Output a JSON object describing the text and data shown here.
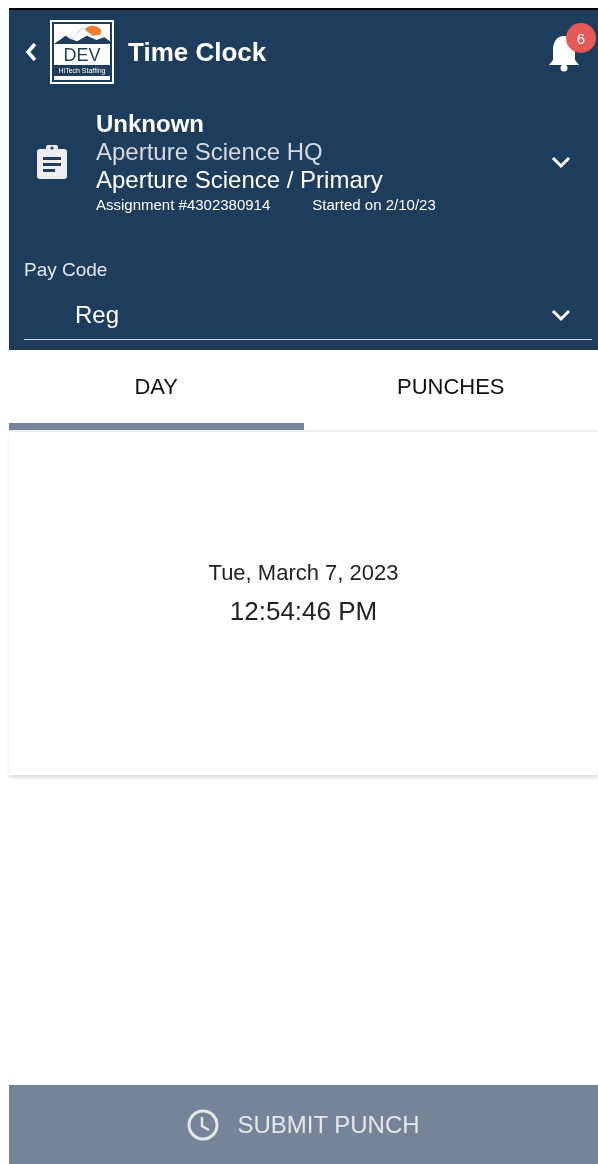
{
  "header": {
    "title": "Time Clock",
    "logo": {
      "main": "DEV",
      "sub": "HiTech Staffing"
    },
    "notification_count": "6"
  },
  "assignment": {
    "name": "Unknown",
    "location": "Aperture Science HQ",
    "client": "Aperture Science / Primary",
    "number": "Assignment #4302380914",
    "started": "Started on 2/10/23"
  },
  "pay_code": {
    "label": "Pay Code",
    "value": "Reg"
  },
  "tabs": [
    {
      "label": "DAY",
      "selected": true
    },
    {
      "label": "PUNCHES",
      "selected": false
    }
  ],
  "day": {
    "date": "Tue, March 7, 2023",
    "time": "12:54:46 PM"
  },
  "submit_button": {
    "label": "SUBMIT PUNCH",
    "disabled": true
  }
}
